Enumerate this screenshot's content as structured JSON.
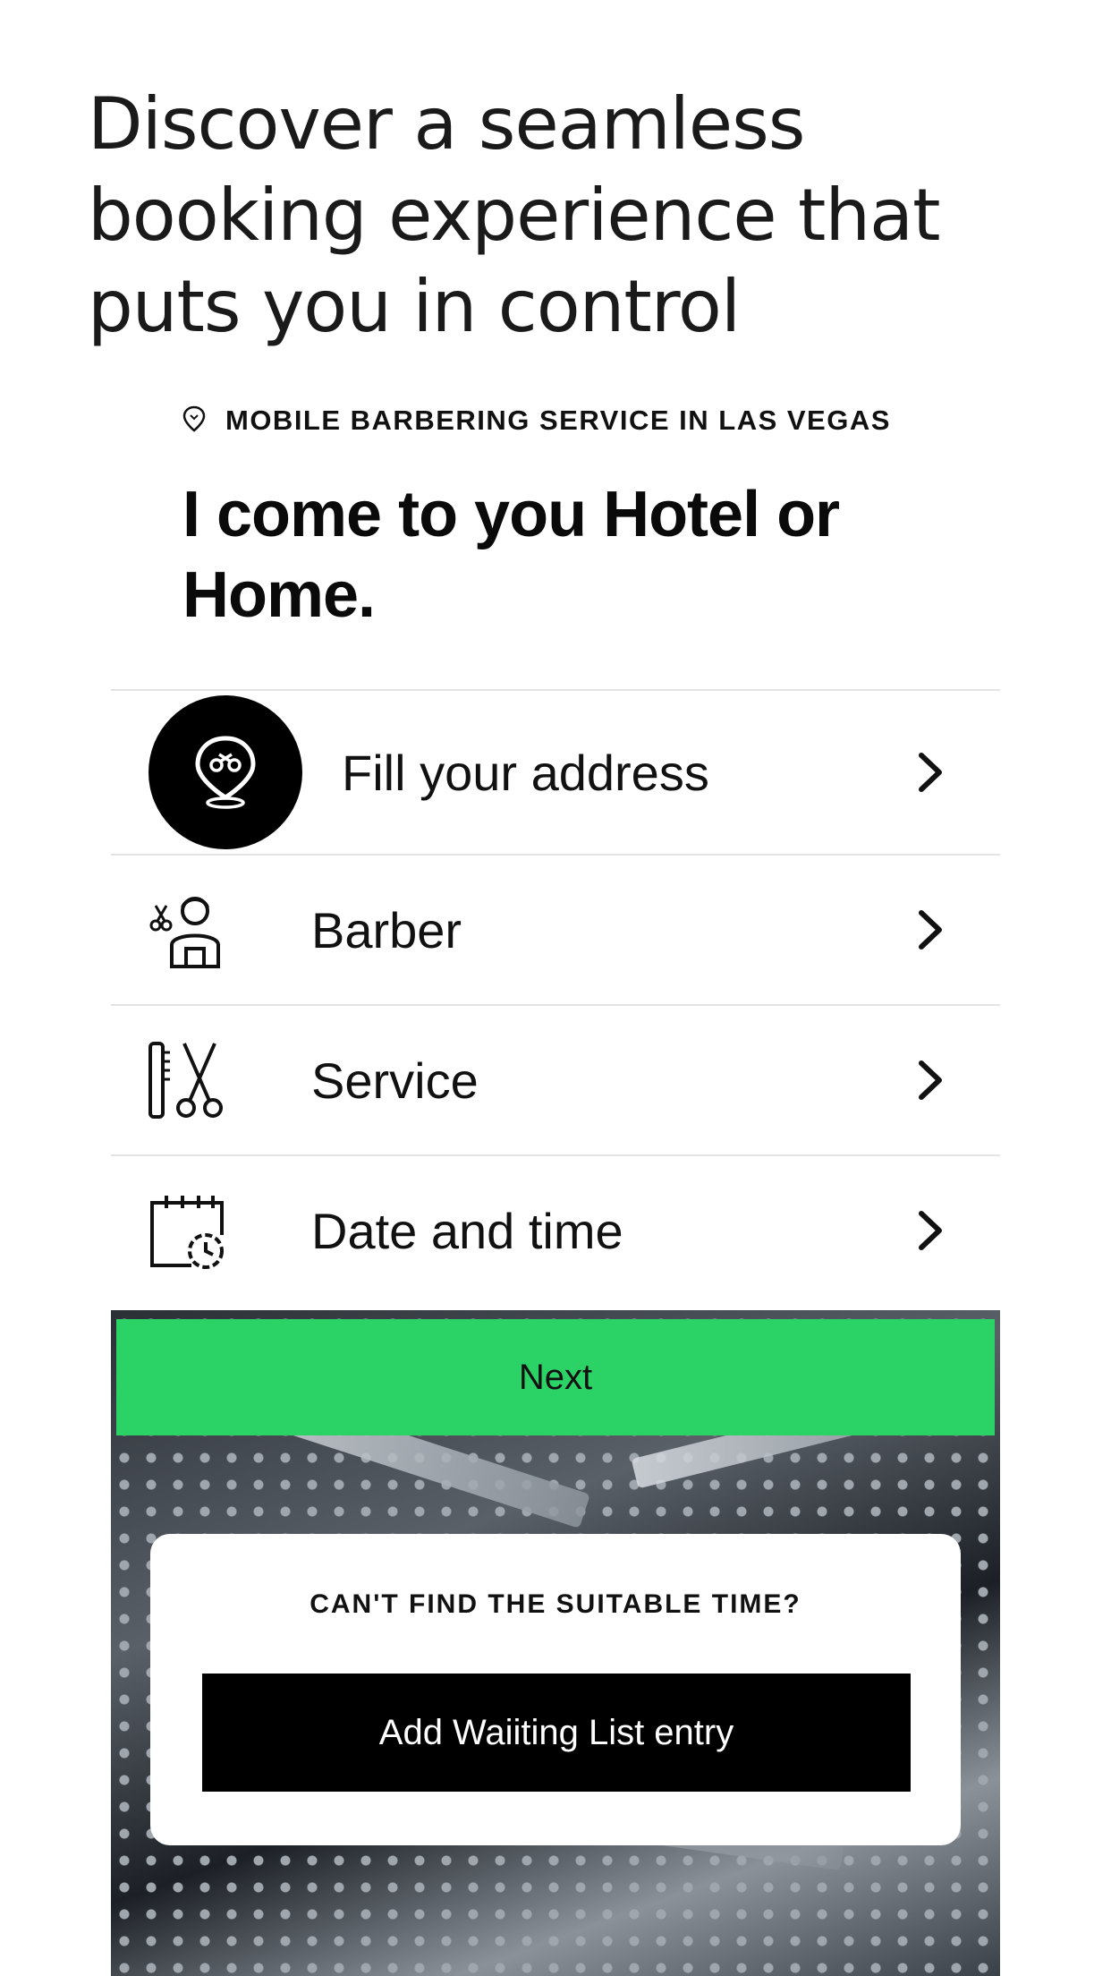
{
  "headline": "Discover a seamless booking experience that puts you in control",
  "app": {
    "location_label": "MOBILE BARBERING SERVICE IN LAS VEGAS",
    "hero_title": "I come to you Hotel or Home.",
    "menu": [
      {
        "label": "Fill your address",
        "icon": "map-pin-scissors-icon"
      },
      {
        "label": "Barber",
        "icon": "barber-person-icon"
      },
      {
        "label": "Service",
        "icon": "comb-scissors-icon"
      },
      {
        "label": "Date and time",
        "icon": "calendar-clock-icon"
      }
    ],
    "next_label": "Next",
    "waitlist": {
      "title": "CAN'T FIND THE SUITABLE TIME?",
      "button_label": "Add Waiiting List entry"
    }
  },
  "colors": {
    "accent_green": "#2bd367",
    "black": "#000000"
  }
}
